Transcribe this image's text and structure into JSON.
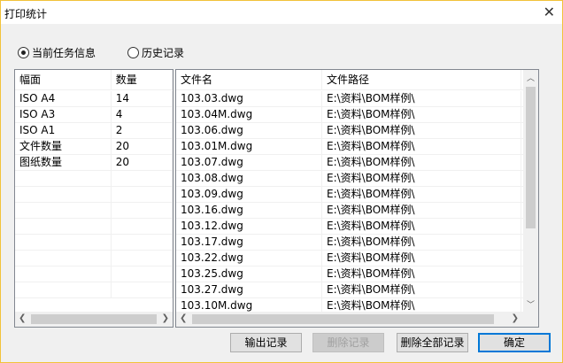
{
  "window": {
    "title": "打印统计",
    "close_icon": "close-icon"
  },
  "radios": [
    {
      "label": "当前任务信息",
      "checked": true
    },
    {
      "label": "历史记录",
      "checked": false
    }
  ],
  "summary_table": {
    "headers": [
      "幅面",
      "数量"
    ],
    "rows": [
      [
        "ISO A4",
        "14"
      ],
      [
        "ISO A3",
        "4"
      ],
      [
        "ISO A1",
        "2"
      ],
      [
        "文件数量",
        "20"
      ],
      [
        "图纸数量",
        "20"
      ]
    ]
  },
  "files_table": {
    "headers": [
      "文件名",
      "文件路径"
    ],
    "rows": [
      [
        "103.03.dwg",
        "E:\\资料\\BOM样例\\"
      ],
      [
        "103.04M.dwg",
        "E:\\资料\\BOM样例\\"
      ],
      [
        "103.06.dwg",
        "E:\\资料\\BOM样例\\"
      ],
      [
        "103.01M.dwg",
        "E:\\资料\\BOM样例\\"
      ],
      [
        "103.07.dwg",
        "E:\\资料\\BOM样例\\"
      ],
      [
        "103.08.dwg",
        "E:\\资料\\BOM样例\\"
      ],
      [
        "103.09.dwg",
        "E:\\资料\\BOM样例\\"
      ],
      [
        "103.16.dwg",
        "E:\\资料\\BOM样例\\"
      ],
      [
        "103.12.dwg",
        "E:\\资料\\BOM样例\\"
      ],
      [
        "103.17.dwg",
        "E:\\资料\\BOM样例\\"
      ],
      [
        "103.22.dwg",
        "E:\\资料\\BOM样例\\"
      ],
      [
        "103.25.dwg",
        "E:\\资料\\BOM样例\\"
      ],
      [
        "103.27.dwg",
        "E:\\资料\\BOM样例\\"
      ],
      [
        "103.10M.dwg",
        "E:\\资料\\BOM样例\\"
      ]
    ]
  },
  "buttons": {
    "export": "输出记录",
    "delete": "删除记录",
    "delete_all": "删除全部记录",
    "ok": "确定"
  },
  "colors": {
    "window_border": "#f2c23a",
    "default_button": "#0078d7"
  }
}
